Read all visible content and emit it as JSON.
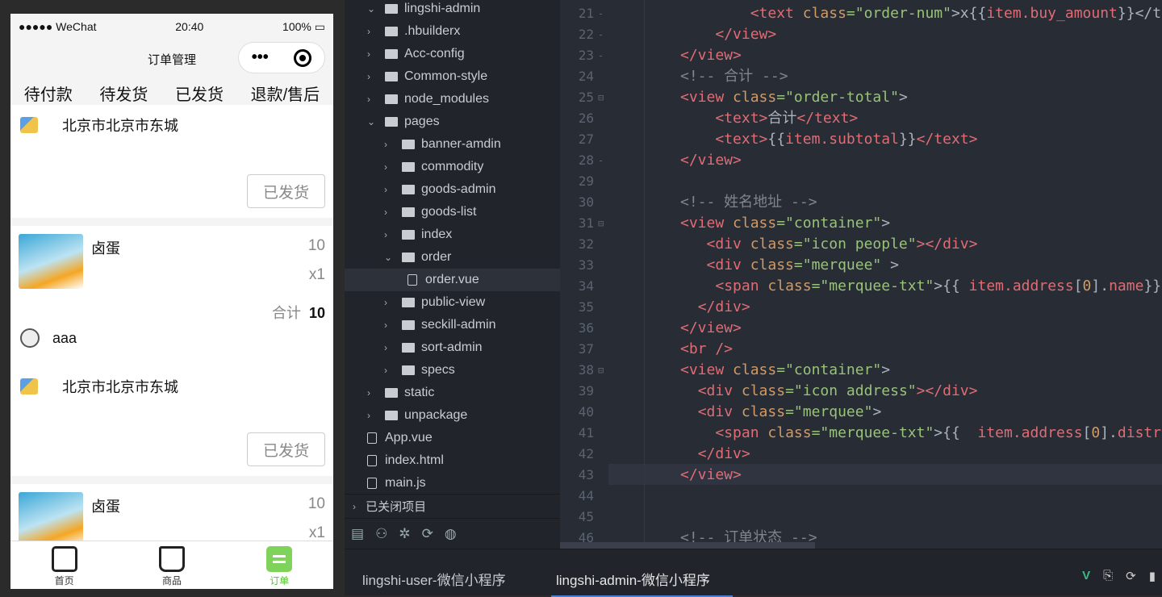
{
  "phone": {
    "status": {
      "carrier": "●●●●● WeChat",
      "time": "20:40",
      "battery": "100%"
    },
    "title": "订单管理",
    "capsule_more": "•••",
    "tabs": [
      "待付款",
      "待发货",
      "已发货",
      "退款/售后"
    ],
    "active_tab": 3,
    "cards": [
      {
        "address": "北京市北京市东城",
        "button": "已发货"
      },
      {
        "goods_name": "卤蛋",
        "price": "10",
        "qty": "x1",
        "total_label": "合计",
        "total": "10",
        "name": "aaa",
        "address": "北京市北京市东城",
        "button": "已发货"
      },
      {
        "goods_name": "卤蛋",
        "price": "10",
        "qty": "x1"
      }
    ],
    "tabbar": [
      "首页",
      "商品",
      "订单"
    ]
  },
  "tree": {
    "items": [
      {
        "label": "lingshi-admin",
        "level": 0,
        "type": "project",
        "open": true
      },
      {
        "label": ".hbuilderx",
        "level": 1,
        "type": "folder"
      },
      {
        "label": "Acc-config",
        "level": 1,
        "type": "folder"
      },
      {
        "label": "Common-style",
        "level": 1,
        "type": "folder"
      },
      {
        "label": "node_modules",
        "level": 1,
        "type": "folder"
      },
      {
        "label": "pages",
        "level": 1,
        "type": "folder",
        "open": true
      },
      {
        "label": "banner-amdin",
        "level": 2,
        "type": "folder"
      },
      {
        "label": "commodity",
        "level": 2,
        "type": "folder"
      },
      {
        "label": "goods-admin",
        "level": 2,
        "type": "folder"
      },
      {
        "label": "goods-list",
        "level": 2,
        "type": "folder"
      },
      {
        "label": "index",
        "level": 2,
        "type": "folder"
      },
      {
        "label": "order",
        "level": 2,
        "type": "folder",
        "open": true
      },
      {
        "label": "order.vue",
        "level": 3,
        "type": "file",
        "selected": true
      },
      {
        "label": "public-view",
        "level": 2,
        "type": "folder"
      },
      {
        "label": "seckill-admin",
        "level": 2,
        "type": "folder"
      },
      {
        "label": "sort-admin",
        "level": 2,
        "type": "folder"
      },
      {
        "label": "specs",
        "level": 2,
        "type": "folder"
      },
      {
        "label": "static",
        "level": 1,
        "type": "folder"
      },
      {
        "label": "unpackage",
        "level": 1,
        "type": "folder"
      },
      {
        "label": "App.vue",
        "level": 1,
        "type": "file"
      },
      {
        "label": "index.html",
        "level": 1,
        "type": "file"
      },
      {
        "label": "main.js",
        "level": 1,
        "type": "file"
      }
    ],
    "closed_projects": "已关闭项目"
  },
  "editor": {
    "current_line": 43,
    "lines": [
      {
        "n": 21,
        "fold": "-",
        "t": [
          [
            "        ",
            "txt"
          ],
          [
            "<text ",
            "tag"
          ],
          [
            "class",
            "attr"
          ],
          [
            "=\"order-num\"",
            "str"
          ],
          [
            ">x{{",
            "txt"
          ],
          [
            "item.buy_amount",
            "tag"
          ],
          [
            "}}</text>",
            "txt"
          ]
        ]
      },
      {
        "n": 22,
        "fold": "-",
        "t": [
          [
            "    ",
            "txt"
          ],
          [
            "</view>",
            "tag"
          ]
        ]
      },
      {
        "n": 23,
        "fold": "-",
        "t": [
          [
            "",
            "txt"
          ],
          [
            "</view>",
            "tag"
          ]
        ]
      },
      {
        "n": 24,
        "fold": "",
        "t": [
          [
            "<!-- 合计 -->",
            "com"
          ]
        ]
      },
      {
        "n": 25,
        "fold": "⊟",
        "t": [
          [
            "<view ",
            "tag"
          ],
          [
            "class",
            "attr"
          ],
          [
            "=\"order-total\"",
            "str"
          ],
          [
            ">",
            "txt"
          ]
        ]
      },
      {
        "n": 26,
        "fold": "",
        "t": [
          [
            "    ",
            "txt"
          ],
          [
            "<text>",
            "tag"
          ],
          [
            "合计",
            "txt"
          ],
          [
            "</text>",
            "tag"
          ]
        ]
      },
      {
        "n": 27,
        "fold": "",
        "t": [
          [
            "    ",
            "txt"
          ],
          [
            "<text>",
            "tag"
          ],
          [
            "{{",
            "txt"
          ],
          [
            "item.subtotal",
            "tag"
          ],
          [
            "}}",
            "txt"
          ],
          [
            "</text>",
            "tag"
          ]
        ]
      },
      {
        "n": 28,
        "fold": "-",
        "t": [
          [
            "</view>",
            "tag"
          ]
        ]
      },
      {
        "n": 29,
        "fold": "",
        "t": []
      },
      {
        "n": 30,
        "fold": "",
        "t": [
          [
            "<!-- 姓名地址 -->",
            "com"
          ]
        ]
      },
      {
        "n": 31,
        "fold": "⊟",
        "t": [
          [
            "<view ",
            "tag"
          ],
          [
            "class",
            "attr"
          ],
          [
            "=\"container\"",
            "str"
          ],
          [
            ">",
            "txt"
          ]
        ]
      },
      {
        "n": 32,
        "fold": "",
        "t": [
          [
            "   ",
            "txt"
          ],
          [
            "<div ",
            "tag"
          ],
          [
            "class",
            "attr"
          ],
          [
            "=\"icon people\"",
            "str"
          ],
          [
            "></div>",
            "tag"
          ]
        ]
      },
      {
        "n": 33,
        "fold": "",
        "t": [
          [
            "   ",
            "txt"
          ],
          [
            "<div ",
            "tag"
          ],
          [
            "class",
            "attr"
          ],
          [
            "=\"merquee\"",
            "str"
          ],
          [
            " >",
            "txt"
          ]
        ]
      },
      {
        "n": 34,
        "fold": "",
        "t": [
          [
            "    ",
            "txt"
          ],
          [
            "<span ",
            "tag"
          ],
          [
            "class",
            "attr"
          ],
          [
            "=\"merquee-txt\"",
            "str"
          ],
          [
            ">{{ ",
            "txt"
          ],
          [
            "item.address",
            "tag"
          ],
          [
            "[",
            "txt"
          ],
          [
            "0",
            "attr"
          ],
          [
            "].",
            "txt"
          ],
          [
            "name",
            "tag"
          ],
          [
            "}}",
            "txt"
          ]
        ]
      },
      {
        "n": 35,
        "fold": "",
        "t": [
          [
            "  ",
            "txt"
          ],
          [
            "</div>",
            "tag"
          ]
        ]
      },
      {
        "n": 36,
        "fold": "",
        "t": [
          [
            "</view>",
            "tag"
          ]
        ]
      },
      {
        "n": 37,
        "fold": "",
        "t": [
          [
            "<br />",
            "tag"
          ]
        ]
      },
      {
        "n": 38,
        "fold": "⊟",
        "t": [
          [
            "<view ",
            "tag"
          ],
          [
            "class",
            "attr"
          ],
          [
            "=\"container\"",
            "str"
          ],
          [
            ">",
            "txt"
          ]
        ]
      },
      {
        "n": 39,
        "fold": "",
        "t": [
          [
            "  ",
            "txt"
          ],
          [
            "<div ",
            "tag"
          ],
          [
            "class",
            "attr"
          ],
          [
            "=\"icon address\"",
            "str"
          ],
          [
            "></div>",
            "tag"
          ]
        ]
      },
      {
        "n": 40,
        "fold": "",
        "t": [
          [
            "  ",
            "txt"
          ],
          [
            "<div ",
            "tag"
          ],
          [
            "class",
            "attr"
          ],
          [
            "=\"merquee\"",
            "str"
          ],
          [
            ">",
            "txt"
          ]
        ]
      },
      {
        "n": 41,
        "fold": "",
        "t": [
          [
            "    ",
            "txt"
          ],
          [
            "<span ",
            "tag"
          ],
          [
            "class",
            "attr"
          ],
          [
            "=\"merquee-txt\"",
            "str"
          ],
          [
            ">{{  ",
            "txt"
          ],
          [
            "item.address",
            "tag"
          ],
          [
            "[",
            "txt"
          ],
          [
            "0",
            "attr"
          ],
          [
            "].",
            "txt"
          ],
          [
            "district",
            "tag"
          ]
        ]
      },
      {
        "n": 42,
        "fold": "",
        "t": [
          [
            "  ",
            "txt"
          ],
          [
            "</div>",
            "tag"
          ]
        ]
      },
      {
        "n": 43,
        "fold": "",
        "t": [
          [
            "</view>",
            "tag"
          ]
        ]
      },
      {
        "n": 44,
        "fold": "",
        "t": []
      },
      {
        "n": 45,
        "fold": "",
        "t": []
      },
      {
        "n": 46,
        "fold": "",
        "t": [
          [
            "<!-- 订单状态 -->",
            "com"
          ]
        ]
      }
    ]
  },
  "bottom": {
    "tabs": [
      "lingshi-user-微信小程序",
      "lingshi-admin-微信小程序"
    ],
    "active": 1,
    "icons": [
      "V",
      "⎘",
      "⟳",
      "▮"
    ]
  }
}
